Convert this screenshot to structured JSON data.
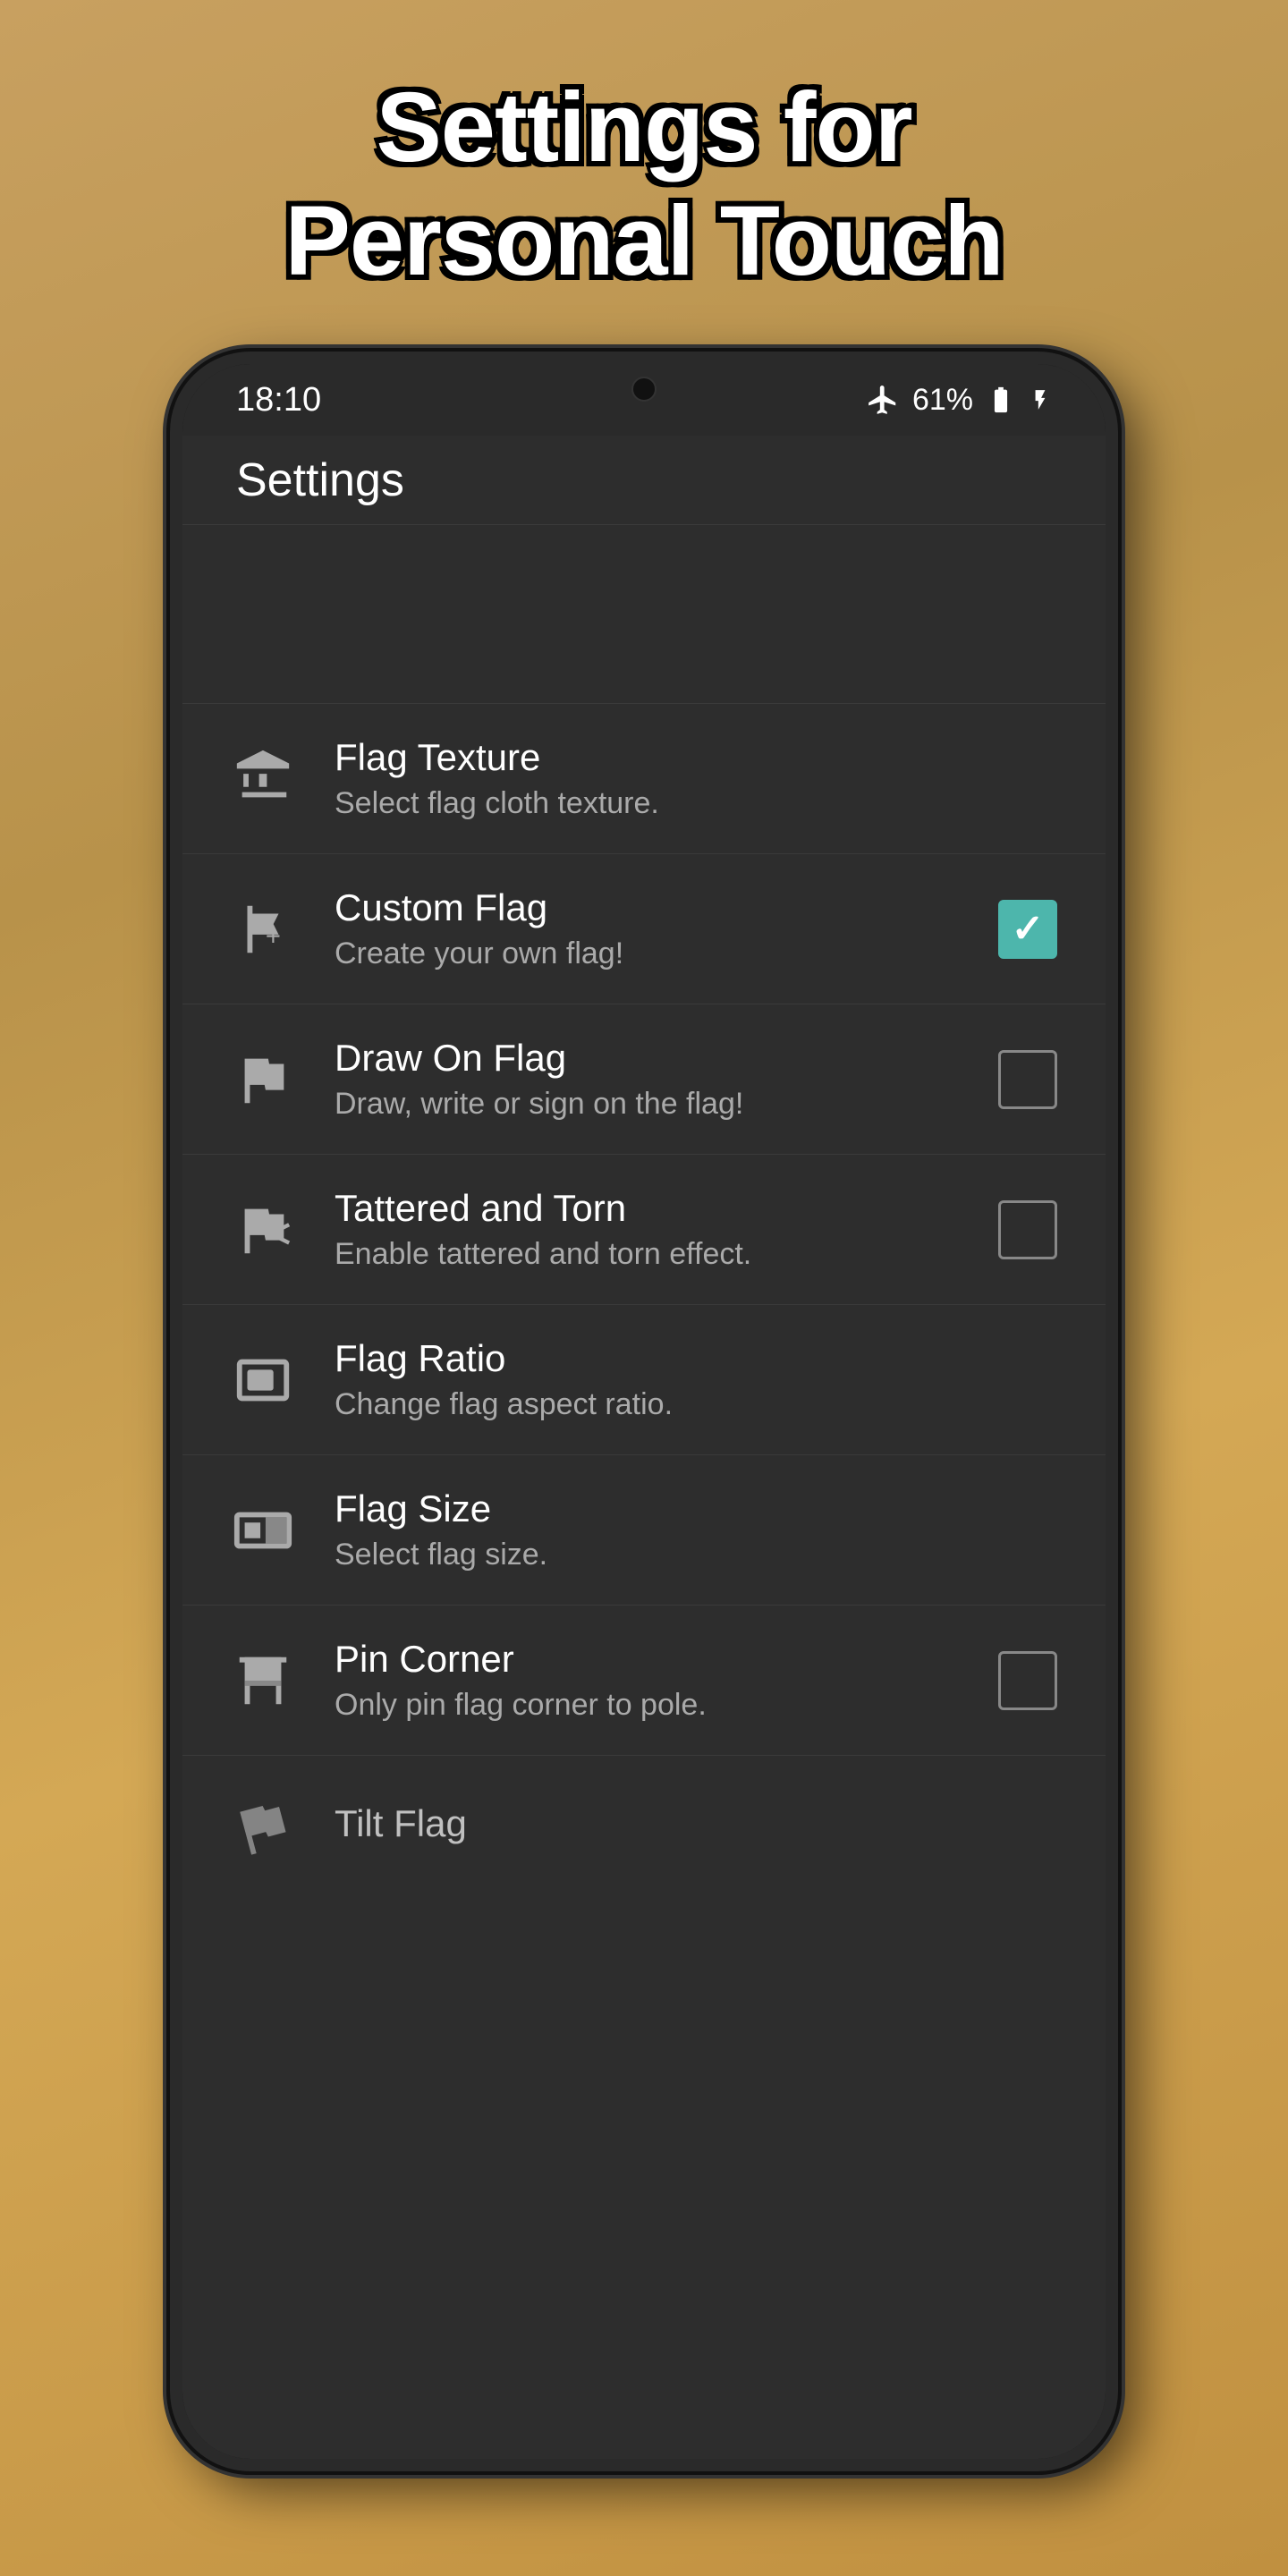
{
  "page": {
    "title_line1": "Settings for",
    "title_line2": "Personal Touch"
  },
  "status_bar": {
    "time": "18:10",
    "battery": "61%",
    "airplane_mode": true
  },
  "app_header": {
    "title": "Settings"
  },
  "settings_items": [
    {
      "id": "flag-texture",
      "icon": "flag-texture-icon",
      "title": "Flag Texture",
      "subtitle": "Select flag cloth texture.",
      "control": "none"
    },
    {
      "id": "custom-flag",
      "icon": "custom-flag-icon",
      "title": "Custom Flag",
      "subtitle": "Create your own flag!",
      "control": "checkbox",
      "checked": true
    },
    {
      "id": "draw-on-flag",
      "icon": "draw-flag-icon",
      "title": "Draw On Flag",
      "subtitle": "Draw, write or sign on the flag!",
      "control": "checkbox",
      "checked": false
    },
    {
      "id": "tattered-torn",
      "icon": "tattered-icon",
      "title": "Tattered and Torn",
      "subtitle": "Enable tattered and torn effect.",
      "control": "checkbox",
      "checked": false
    },
    {
      "id": "flag-ratio",
      "icon": "ratio-icon",
      "title": "Flag Ratio",
      "subtitle": "Change flag aspect ratio.",
      "control": "none"
    },
    {
      "id": "flag-size",
      "icon": "size-icon",
      "title": "Flag Size",
      "subtitle": "Select flag size.",
      "control": "none"
    },
    {
      "id": "pin-corner",
      "icon": "pin-icon",
      "title": "Pin Corner",
      "subtitle": "Only pin flag corner to pole.",
      "control": "checkbox",
      "checked": false
    },
    {
      "id": "tilt-flag",
      "icon": "tilt-icon",
      "title": "Tilt Flag",
      "subtitle": "",
      "control": "none",
      "partial": true
    }
  ]
}
